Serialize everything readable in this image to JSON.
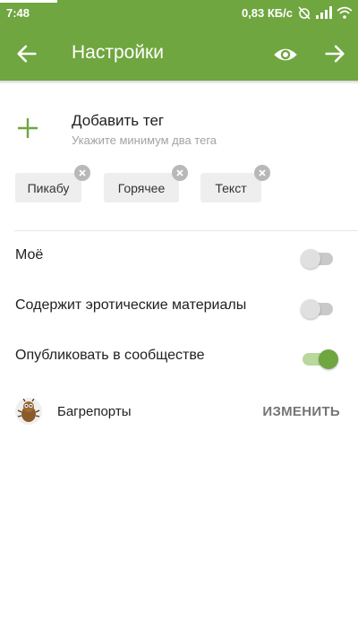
{
  "status_bar": {
    "time": "7:48",
    "network_speed": "0,83 КБ/с",
    "icons": [
      "alarm-off-icon",
      "signal-icon",
      "wifi-icon"
    ]
  },
  "app_bar": {
    "title": "Настройки",
    "icons": [
      "back-arrow-icon",
      "eye-icon",
      "forward-arrow-icon"
    ]
  },
  "add_tag": {
    "label": "Добавить тег",
    "hint": "Укажите минимум два тега"
  },
  "tags": [
    {
      "label": "Пикабу"
    },
    {
      "label": "Горячее"
    },
    {
      "label": "Текст"
    }
  ],
  "settings": [
    {
      "label": "Моё",
      "enabled": false
    },
    {
      "label": "Содержит эротические материалы",
      "enabled": false
    },
    {
      "label": "Опубликовать в сообществе",
      "enabled": true
    }
  ],
  "community": {
    "name": "Багрепорты",
    "action_label": "ИЗМЕНИТЬ"
  },
  "colors": {
    "accent": "#6fa63f",
    "toggle_on_track": "#b8d99b",
    "hint_text": "#a3a3a3",
    "chip_bg": "#eeeeee"
  }
}
